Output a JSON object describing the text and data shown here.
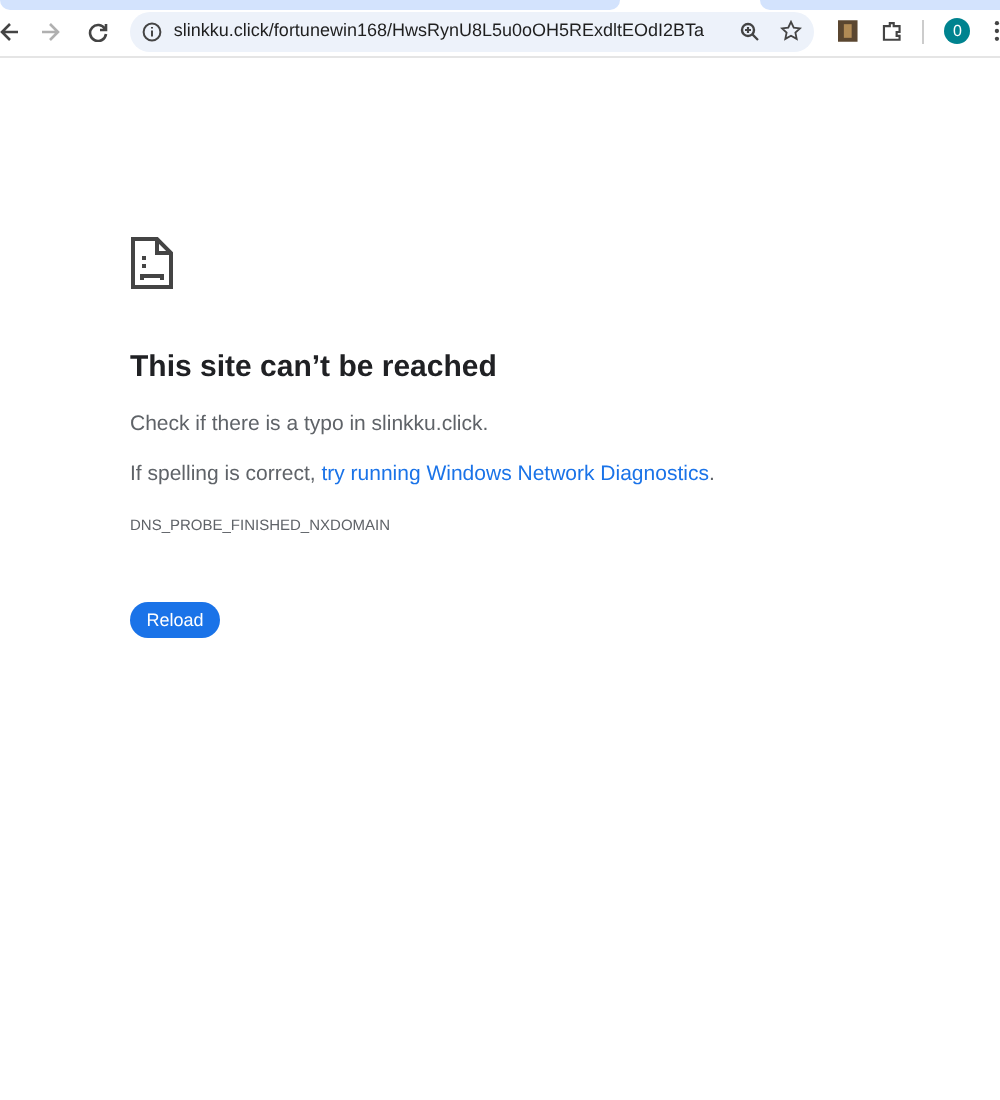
{
  "toolbar": {
    "url": "slinkku.click/fortunewin168/HwsRynU8L5u0oOH5RExdltEOdI2BTa",
    "back_disabled": false,
    "forward_disabled": true,
    "profile_letter": "0"
  },
  "error": {
    "title": "This site can’t be reached",
    "hint": "Check if there is a typo in slinkku.click.",
    "suggestion_prefix": "If spelling is correct, ",
    "suggestion_link": "try running Windows Network Diagnostics",
    "suggestion_suffix": ".",
    "code": "DNS_PROBE_FINISHED_NXDOMAIN",
    "button": "Reload"
  }
}
